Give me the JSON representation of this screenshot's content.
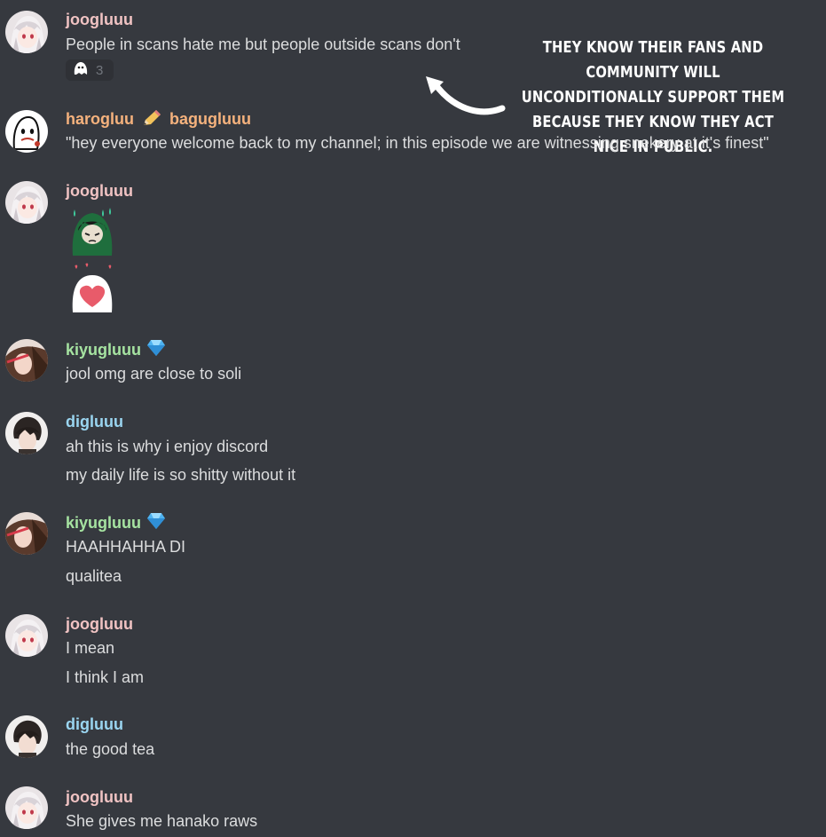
{
  "colors": {
    "background": "#36393f",
    "text": "#dcddde",
    "username_joogluuu": "#f0c3c3",
    "username_harogluu": "#f5b27d",
    "username_kiyugluuu": "#a6e3a1",
    "username_digluuu": "#9ad5f0"
  },
  "annotation": {
    "text": "THEY KNOW THEIR FANS AND COMMUNITY WILL UNCONDITIONALLY SUPPORT THEM BECAUSE THEY KNOW THEY ACT NICE IN PUBLIC.",
    "arrow_icon": "curved-arrow-icon"
  },
  "messages": [
    {
      "username": "joogluuu",
      "lines": [
        "People in scans hate me but people outside scans don't"
      ],
      "reaction": {
        "icon": "ghost-emoji-icon",
        "count": "3"
      }
    },
    {
      "username": "harogluu",
      "username_icon": "pencil-emoji-icon",
      "username_suffix": "bagugluuu",
      "lines": [
        "\"hey everyone welcome back to my channel; in this episode we are witnessing snekery at it's finest\""
      ]
    },
    {
      "username": "joogluuu",
      "stickers": [
        "sweating-character-sticker",
        "heart-ghost-sticker"
      ]
    },
    {
      "username": "kiyugluuu",
      "badge_icon": "diamond-icon",
      "lines": [
        "jool omg are close to soli"
      ]
    },
    {
      "username": "digluuu",
      "lines": [
        "ah this is why i enjoy discord",
        "my daily life is so shitty without it"
      ]
    },
    {
      "username": "kiyugluuu",
      "badge_icon": "diamond-icon",
      "lines": [
        "HAAHHAHHA DI",
        "qualitea"
      ]
    },
    {
      "username": "joogluuu",
      "lines": [
        "I mean",
        "I think I am"
      ]
    },
    {
      "username": "digluuu",
      "lines": [
        "the good tea"
      ]
    },
    {
      "username": "joogluuu",
      "lines": [
        "She gives me hanako raws"
      ]
    }
  ]
}
